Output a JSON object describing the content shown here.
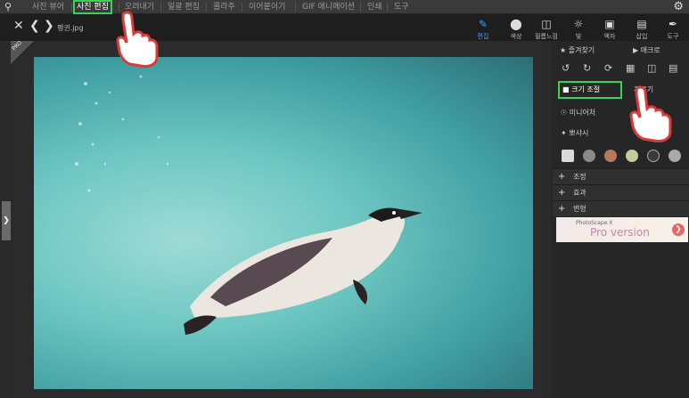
{
  "app_icon": "search-circle-icon",
  "tabs": [
    "사진 뷰어",
    "사진 편집",
    "오려내기",
    "일괄 편집",
    "콜라주",
    "이어붙이기",
    "GIF 애니메이션",
    "인쇄",
    "도구"
  ],
  "active_tab_index": 1,
  "settings_icon": "gear-icon",
  "file": {
    "name": "펭귄.jpg"
  },
  "toolbar": {
    "tools": [
      {
        "label": "편집",
        "icon": "edit-icon"
      },
      {
        "label": "색상",
        "icon": "color-circle-icon"
      },
      {
        "label": "필름느낌",
        "icon": "film-icon"
      },
      {
        "label": "빛",
        "icon": "light-icon"
      },
      {
        "label": "액자",
        "icon": "frame-icon"
      },
      {
        "label": "삽입",
        "icon": "insert-icon"
      },
      {
        "label": "도구",
        "icon": "brush-icon"
      }
    ]
  },
  "panel": {
    "favorites_label": "즐겨찾기",
    "macro_label": "매크로",
    "resize_label": "크기 조절",
    "crop_label": "자르기",
    "miniature_label": "미니어처",
    "sharpen_label": "뽀샤시",
    "sections": [
      "조정",
      "효과",
      "변형"
    ],
    "promo_line": "PhotoScape X",
    "promo_title": "Pro version",
    "pro_badge": "PRO"
  },
  "colors": {
    "accent_active": "#3aa0ff",
    "highlight_box": "#39d353"
  }
}
